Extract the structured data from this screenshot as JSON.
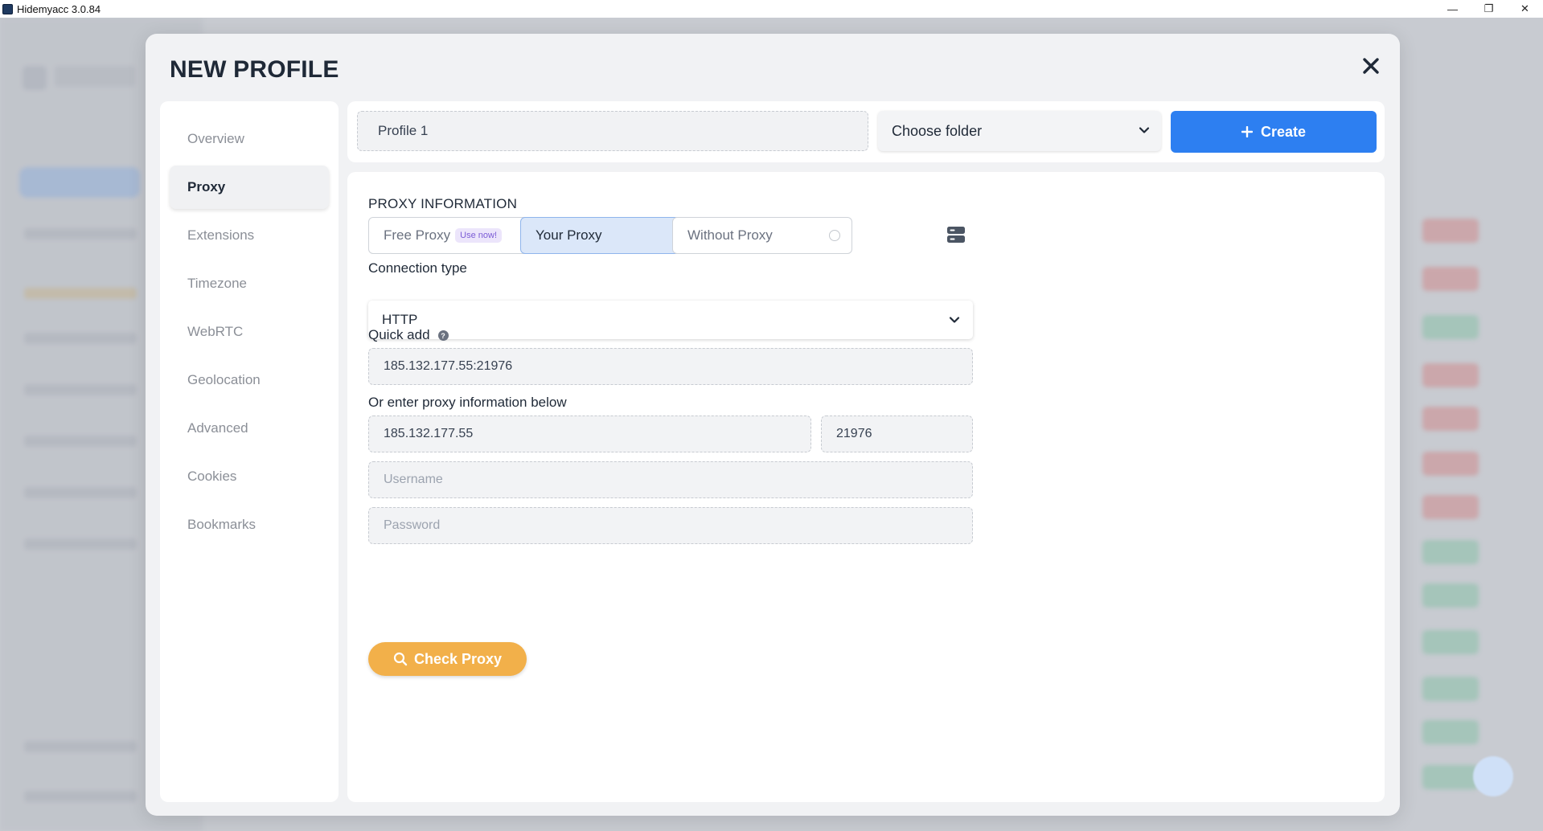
{
  "window": {
    "title": "Hidemyacc 3.0.84",
    "controls": [
      "—",
      "❐",
      "✕"
    ]
  },
  "modal": {
    "title": "NEW PROFILE",
    "nav": [
      {
        "label": "Overview",
        "active": false
      },
      {
        "label": "Proxy",
        "active": true
      },
      {
        "label": "Extensions",
        "active": false
      },
      {
        "label": "Timezone",
        "active": false
      },
      {
        "label": "WebRTC",
        "active": false
      },
      {
        "label": "Geolocation",
        "active": false
      },
      {
        "label": "Advanced",
        "active": false
      },
      {
        "label": "Cookies",
        "active": false
      },
      {
        "label": "Bookmarks",
        "active": false
      }
    ],
    "profile_name": "Profile 1",
    "folder_select": "Choose folder",
    "create_label": "Create",
    "proxy": {
      "section_title": "PROXY INFORMATION",
      "options": {
        "free": {
          "label": "Free Proxy",
          "badge": "Use now!"
        },
        "yours": {
          "label": "Your Proxy"
        },
        "none": {
          "label": "Without Proxy"
        }
      },
      "selected": "yours",
      "connection_type_label": "Connection type",
      "connection_type": "HTTP",
      "quick_add_label": "Quick add",
      "quick_add_value": "185.132.177.55:21976",
      "manual_label": "Or enter proxy information below",
      "host": "185.132.177.55",
      "port": "21976",
      "username_placeholder": "Username",
      "password_placeholder": "Password",
      "check_label": "Check Proxy"
    }
  },
  "colors": {
    "primary": "#2d7ff1",
    "check": "#f2b04a",
    "selected_bg": "#dbe7f9"
  }
}
